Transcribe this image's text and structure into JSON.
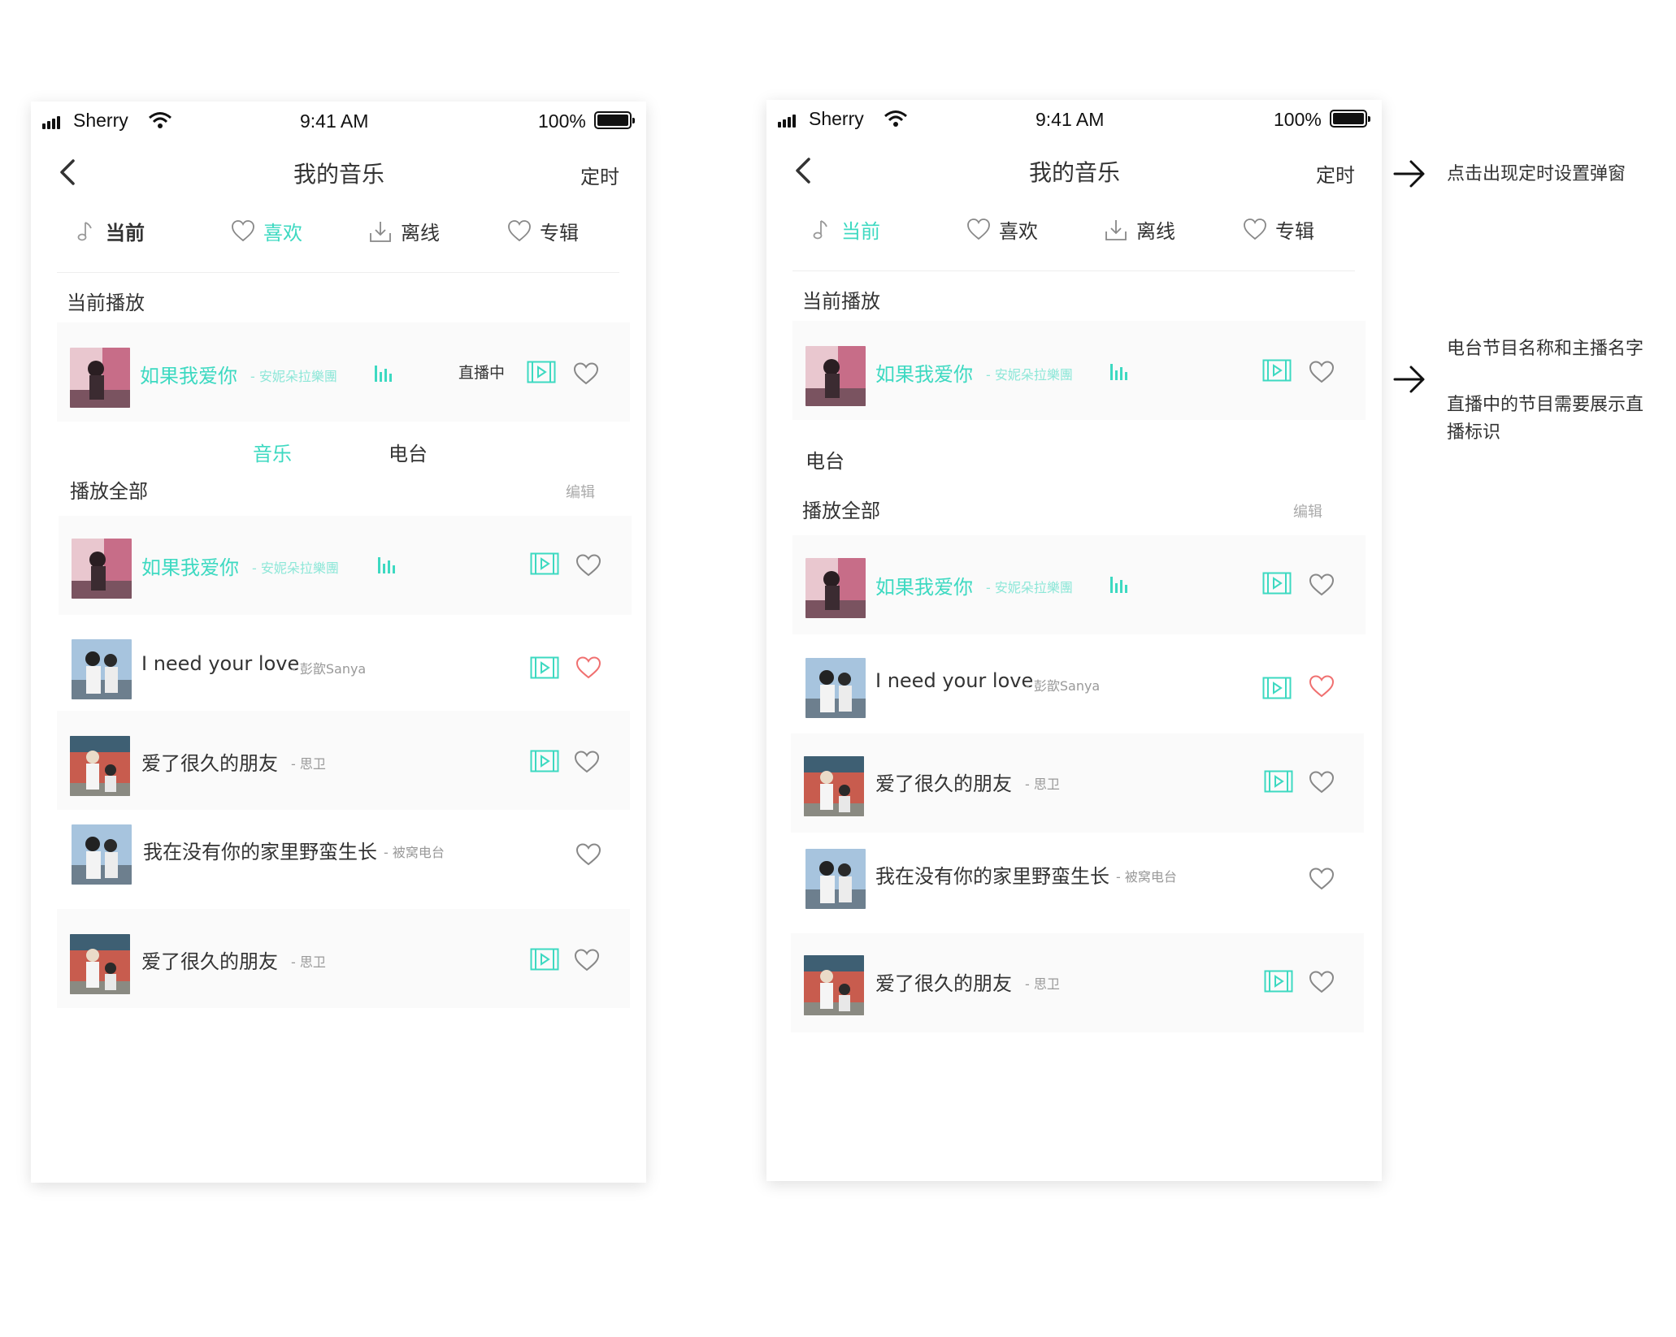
{
  "colors": {
    "accent": "#3dd9c1",
    "heart_active": "#f07070",
    "text": "#333333",
    "muted": "#999999"
  },
  "status_bar": {
    "carrier": "Sherry",
    "time": "9:41 AM",
    "battery": "100%"
  },
  "header": {
    "title": "我的音乐",
    "right_action": "定时",
    "back_icon": "chevron-left-icon"
  },
  "tabs": [
    {
      "label": "当前",
      "icon": "music-note-icon"
    },
    {
      "label": "喜欢",
      "icon": "heart-icon"
    },
    {
      "label": "离线",
      "icon": "download-icon"
    },
    {
      "label": "专辑",
      "icon": "heart-icon"
    }
  ],
  "now_playing": {
    "section_title": "当前播放",
    "song": "如果我爱你",
    "artist": "- 安妮朵拉樂團",
    "live_label": "直播中"
  },
  "sub_tabs": {
    "music": "音乐",
    "radio": "电台"
  },
  "playlist": {
    "play_all": "播放全部",
    "edit": "编辑",
    "items": [
      {
        "title": "如果我爱你",
        "artist": "- 安妮朵拉樂團",
        "playing": true,
        "mv": true,
        "liked": false
      },
      {
        "title": "I need your love",
        "artist": "- 彭歆Sanya",
        "playing": false,
        "mv": true,
        "liked": true
      },
      {
        "title": "爱了很久的朋友",
        "artist": "- 思卫",
        "playing": false,
        "mv": true,
        "liked": false
      },
      {
        "title": "我在没有你的家里野蛮生长",
        "artist": "- 被窝电台",
        "playing": false,
        "mv": false,
        "liked": false
      },
      {
        "title": "爱了很久的朋友",
        "artist": "- 思卫",
        "playing": false,
        "mv": true,
        "liked": false
      }
    ]
  },
  "annotations": {
    "timer_note": "点击出现定时设置弹窗",
    "radio_note_1": "电台节目名称和主播名字",
    "radio_note_2_line1": "直播中的节目需要展示直",
    "radio_note_2_line2": "播标识"
  }
}
